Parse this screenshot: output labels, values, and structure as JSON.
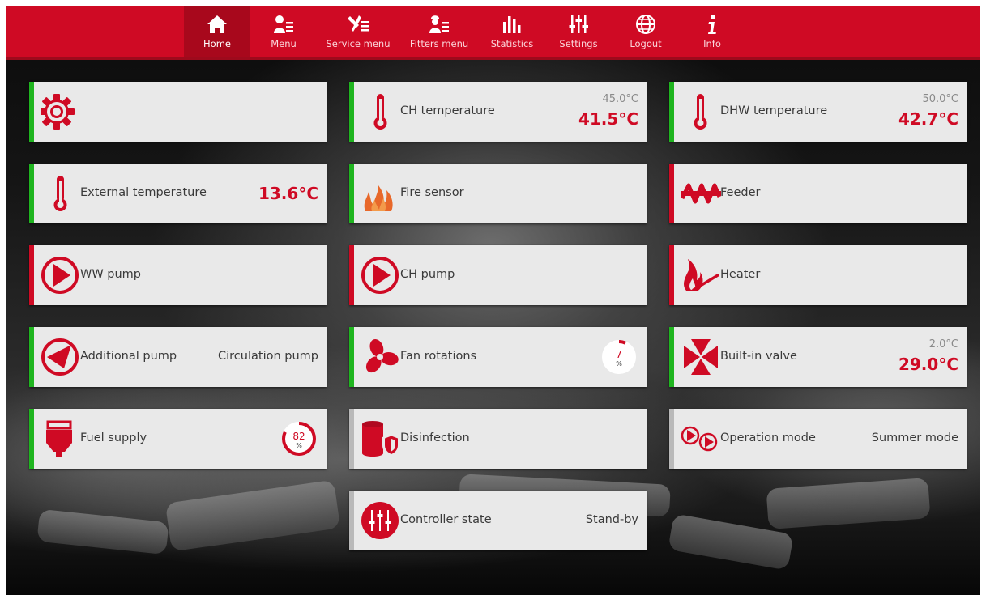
{
  "nav": {
    "items": [
      {
        "label": "Home",
        "icon": "home-icon"
      },
      {
        "label": "Menu",
        "icon": "user-list-icon"
      },
      {
        "label": "Service menu",
        "icon": "tools-icon"
      },
      {
        "label": "Fitters menu",
        "icon": "fitter-icon"
      },
      {
        "label": "Statistics",
        "icon": "bar-chart-icon"
      },
      {
        "label": "Settings",
        "icon": "sliders-icon"
      },
      {
        "label": "Logout",
        "icon": "globe-icon"
      },
      {
        "label": "Info",
        "icon": "info-icon"
      }
    ],
    "active": "Home"
  },
  "tiles": {
    "settings": {
      "icon": "gear-icon"
    },
    "ch_temp": {
      "label": "CH temperature",
      "set": "45.0°C",
      "value": "41.5°C",
      "icon": "thermometer-icon"
    },
    "dhw_temp": {
      "label": "DHW temperature",
      "set": "50.0°C",
      "value": "42.7°C",
      "icon": "thermometer-icon"
    },
    "ext_temp": {
      "label": "External temperature",
      "value": "13.6°C",
      "icon": "thermometer-icon"
    },
    "fire_sensor": {
      "label": "Fire sensor",
      "icon": "flame-icon"
    },
    "feeder": {
      "label": "Feeder",
      "icon": "feeder-screw-icon"
    },
    "ww_pump": {
      "label": "WW pump",
      "icon": "pump-icon"
    },
    "ch_pump": {
      "label": "CH pump",
      "icon": "pump-icon"
    },
    "heater": {
      "label": "Heater",
      "icon": "heater-icon"
    },
    "additional_pump": {
      "label": "Additional pump",
      "value": "Circulation pump",
      "icon": "pump-icon"
    },
    "fan_rotations": {
      "label": "Fan rotations",
      "percent": 7,
      "percent_text": "7",
      "unit": "%",
      "icon": "fan-icon"
    },
    "builtin_valve": {
      "label": "Built-in valve",
      "set": "2.0°C",
      "value": "29.0°C",
      "icon": "valve-icon"
    },
    "fuel_supply": {
      "label": "Fuel supply",
      "percent": 82,
      "percent_text": "82",
      "unit": "%",
      "icon": "hopper-icon"
    },
    "disinfection": {
      "label": "Disinfection",
      "icon": "tank-shield-icon"
    },
    "operation_mode": {
      "label": "Operation mode",
      "value": "Summer mode",
      "icon": "operation-mode-icon"
    },
    "controller_state": {
      "label": "Controller state",
      "value": "Stand-by",
      "icon": "sliders-circle-icon"
    }
  },
  "colors": {
    "accent": "#cf0a24",
    "active_nav": "#a8081c",
    "status_on": "#1fb51f",
    "status_off": "#cf0a24",
    "neutral": "#b9b9b9",
    "flame": "#e8682a"
  }
}
